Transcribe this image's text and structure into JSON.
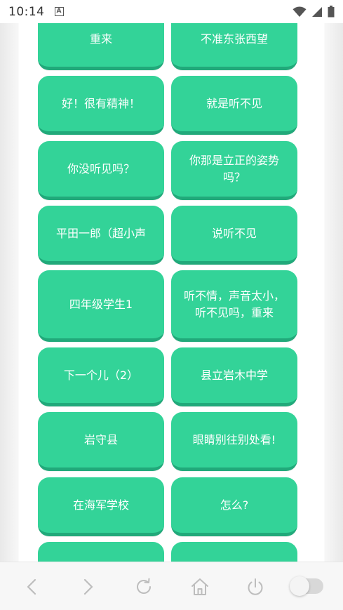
{
  "status_bar": {
    "time": "10:14",
    "notification_letter": "A"
  },
  "buttons": [
    {
      "label": ""
    },
    {
      "label": ""
    },
    {
      "label": "重来"
    },
    {
      "label": "不准东张西望"
    },
    {
      "label": "好！很有精神！"
    },
    {
      "label": "就是听不见"
    },
    {
      "label": "你没听见吗？"
    },
    {
      "label": "你那是立正的姿势吗？"
    },
    {
      "label": "平田一郎（超小声"
    },
    {
      "label": "说听不见"
    },
    {
      "label": "四年级学生1"
    },
    {
      "label": "听不情，声音太小，听不见吗，重来"
    },
    {
      "label": "下一个儿（2）"
    },
    {
      "label": "县立岩木中学"
    },
    {
      "label": "岩守县"
    },
    {
      "label": "眼睛别往别处看!"
    },
    {
      "label": "在海军学校"
    },
    {
      "label": "怎么?"
    },
    {
      "label": ""
    },
    {
      "label": ""
    }
  ],
  "bottom_nav": {
    "icons": [
      "back-icon",
      "forward-icon",
      "refresh-icon",
      "home-icon",
      "power-icon",
      "toggle-switch"
    ]
  },
  "colors": {
    "button": "#33d398",
    "button_shadow": "#21a97a"
  }
}
